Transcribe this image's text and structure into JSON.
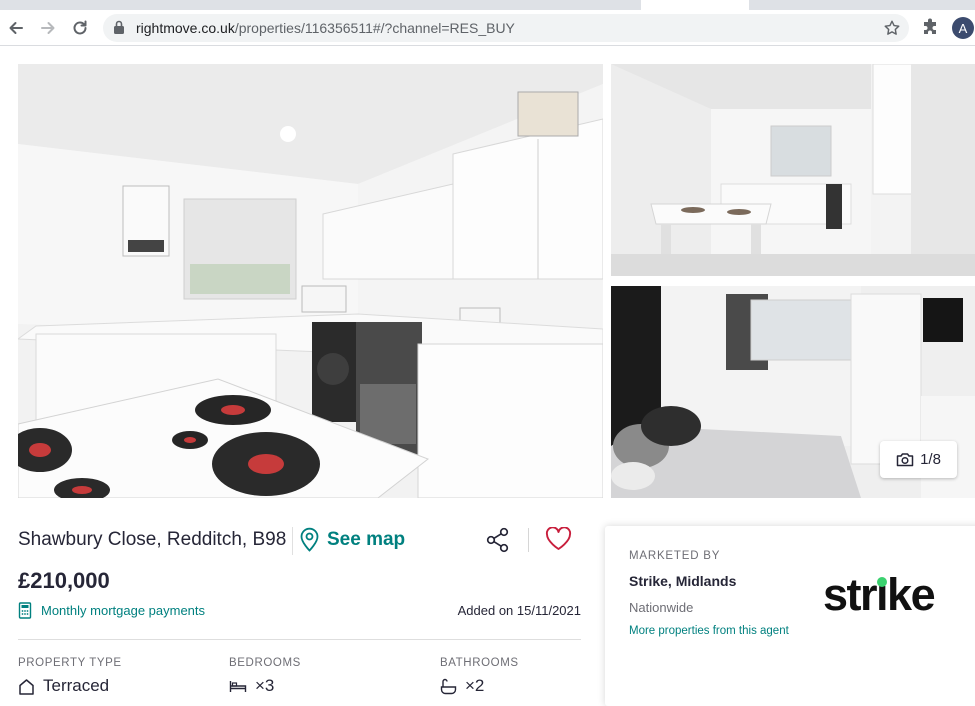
{
  "browser": {
    "url_host": "rightmove.co.uk",
    "url_path": "/properties/116356511#/?channel=RES_BUY",
    "profile_initial": "A",
    "icons": [
      "back-arrow-icon",
      "forward-arrow-icon",
      "reload-icon",
      "lock-icon",
      "star-icon",
      "puzzle-icon"
    ]
  },
  "gallery": {
    "photo_counter": "1/8",
    "icons": [
      "camera-icon"
    ]
  },
  "listing": {
    "address": "Shawbury Close, Redditch, B98",
    "see_map_label": "See map",
    "price": "£210,000",
    "mortgage_label": "Monthly mortgage payments",
    "added_on": "Added on 15/11/2021",
    "icons": [
      "location-pin-icon",
      "share-icon",
      "heart-icon",
      "calculator-icon"
    ]
  },
  "key_features": [
    {
      "label": "PROPERTY TYPE",
      "value": "Terraced",
      "icon": "house-icon"
    },
    {
      "label": "BEDROOMS",
      "value": "×3",
      "icon": "bed-icon"
    },
    {
      "label": "BATHROOMS",
      "value": "×2",
      "icon": "bath-icon"
    }
  ],
  "agent": {
    "marketed_by_label": "MARKETED BY",
    "name": "Strike, Midlands",
    "location": "Nationwide",
    "more_link": "More properties from this agent",
    "logo_text": "strike",
    "logo_accent_color": "#3bd16f"
  },
  "colors": {
    "brand_teal": "#00807f",
    "heart_red": "#c81e3c",
    "text_dark": "#262637"
  }
}
